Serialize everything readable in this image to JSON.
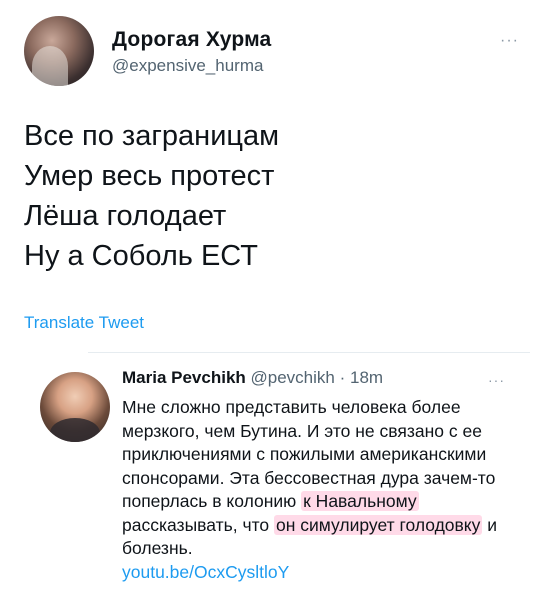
{
  "author": {
    "display_name": "Дорогая Хурма",
    "handle": "@expensive_hurma"
  },
  "tweet": {
    "lines": [
      "Все по заграницам",
      "Умер весь протест",
      "Лёша голодает",
      "Ну а Соболь ЕСТ"
    ],
    "translate_label": "Translate Tweet",
    "more_label": "···"
  },
  "quoted": {
    "author_name": "Maria Pevchikh",
    "handle": "@pevchikh",
    "separator": " · ",
    "time": "18m",
    "more_label": "···",
    "text": {
      "part1": "Мне сложно представить человека более мерзкого, чем Бутина. И это не связано с ее приключениями с пожилыми американскими спонсорами. Эта бессовестная дура зачем-то поперлась в колонию ",
      "highlight1": "к Навальному",
      "part2": " рассказывать, что ",
      "highlight2": "он симулирует голодовку",
      "part3": " и болезнь."
    },
    "link": "youtu.be/OcxCysltloY"
  },
  "colors": {
    "link": "#1d9bf0",
    "secondary": "#536471",
    "highlight": "#ff96be"
  }
}
